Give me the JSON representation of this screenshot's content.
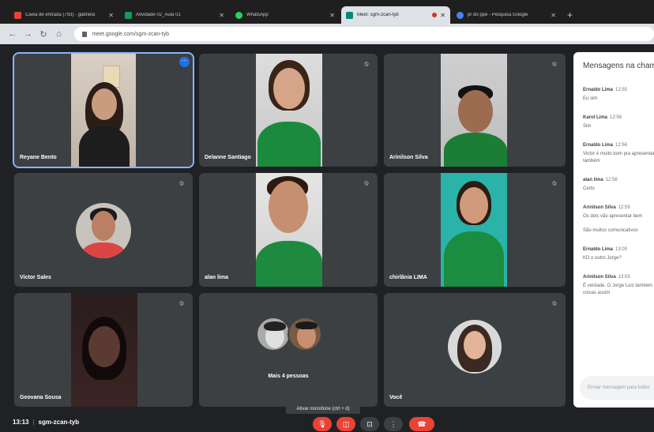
{
  "browser": {
    "tabs": [
      {
        "title": "Caixa de entrada (793) - gabriela",
        "icon": "gmail-icon",
        "color": "#ea4335"
      },
      {
        "title": "Atividade 02_Aula 01",
        "icon": "classroom-icon",
        "color": "#0f9d58"
      },
      {
        "title": "WhatsApp",
        "icon": "whatsapp-icon",
        "color": "#25d366"
      },
      {
        "title": "Meet: sgm-zcan-tyb",
        "icon": "meet-icon",
        "color": "#00897b"
      },
      {
        "title": "pr do ppe - Pesquisa Google",
        "icon": "google-icon",
        "color": "#4285f4"
      }
    ],
    "url": "meet.google.com/sgm-zcan-tyb"
  },
  "participants": [
    {
      "name": "Reyane Bento"
    },
    {
      "name": "Delanne Santiago"
    },
    {
      "name": "Arinilson Silva"
    },
    {
      "name": "Victor Sales"
    },
    {
      "name": "alan lima"
    },
    {
      "name": "chirlânia LIMA"
    },
    {
      "name": "Geovana Sousa"
    },
    {
      "name": "Mais 4 pessoas"
    },
    {
      "name": "Você"
    }
  ],
  "chat": {
    "title": "Mensagens na chamada",
    "messages": [
      {
        "sender": "Ernaldo Lima",
        "time": "12:55",
        "text": "Eu sim"
      },
      {
        "sender": "Karol Lima",
        "time": "12:56",
        "text": "Sim"
      },
      {
        "sender": "Ernaldo Lima",
        "time": "12:56",
        "text": "Victor é muito bom pra apresentar também"
      },
      {
        "sender": "alan lima",
        "time": "12:56",
        "text": "Certo"
      },
      {
        "sender": "Arinilson Silva",
        "time": "12:59",
        "text": "Os dois vão apresentar bem\n\nSão muitos comunicativos"
      },
      {
        "sender": "Ernaldo Lima",
        "time": "13:00",
        "text": "KD o outro Jorge?"
      },
      {
        "sender": "Arinilson Silva",
        "time": "13:03",
        "text": "É verdade. O Jorge Luiz também\ncoisas assim"
      }
    ],
    "input_placeholder": "Enviar mensagem para todos"
  },
  "bottom": {
    "time": "13:13",
    "meeting_code": "sgm-zcan-tyb",
    "tooltip": "Ativar microfone (ctrl + d)"
  },
  "colors": {
    "background": "#202124",
    "tile": "#3c4043",
    "accent": "#8ab4f8",
    "danger": "#ea4335"
  }
}
